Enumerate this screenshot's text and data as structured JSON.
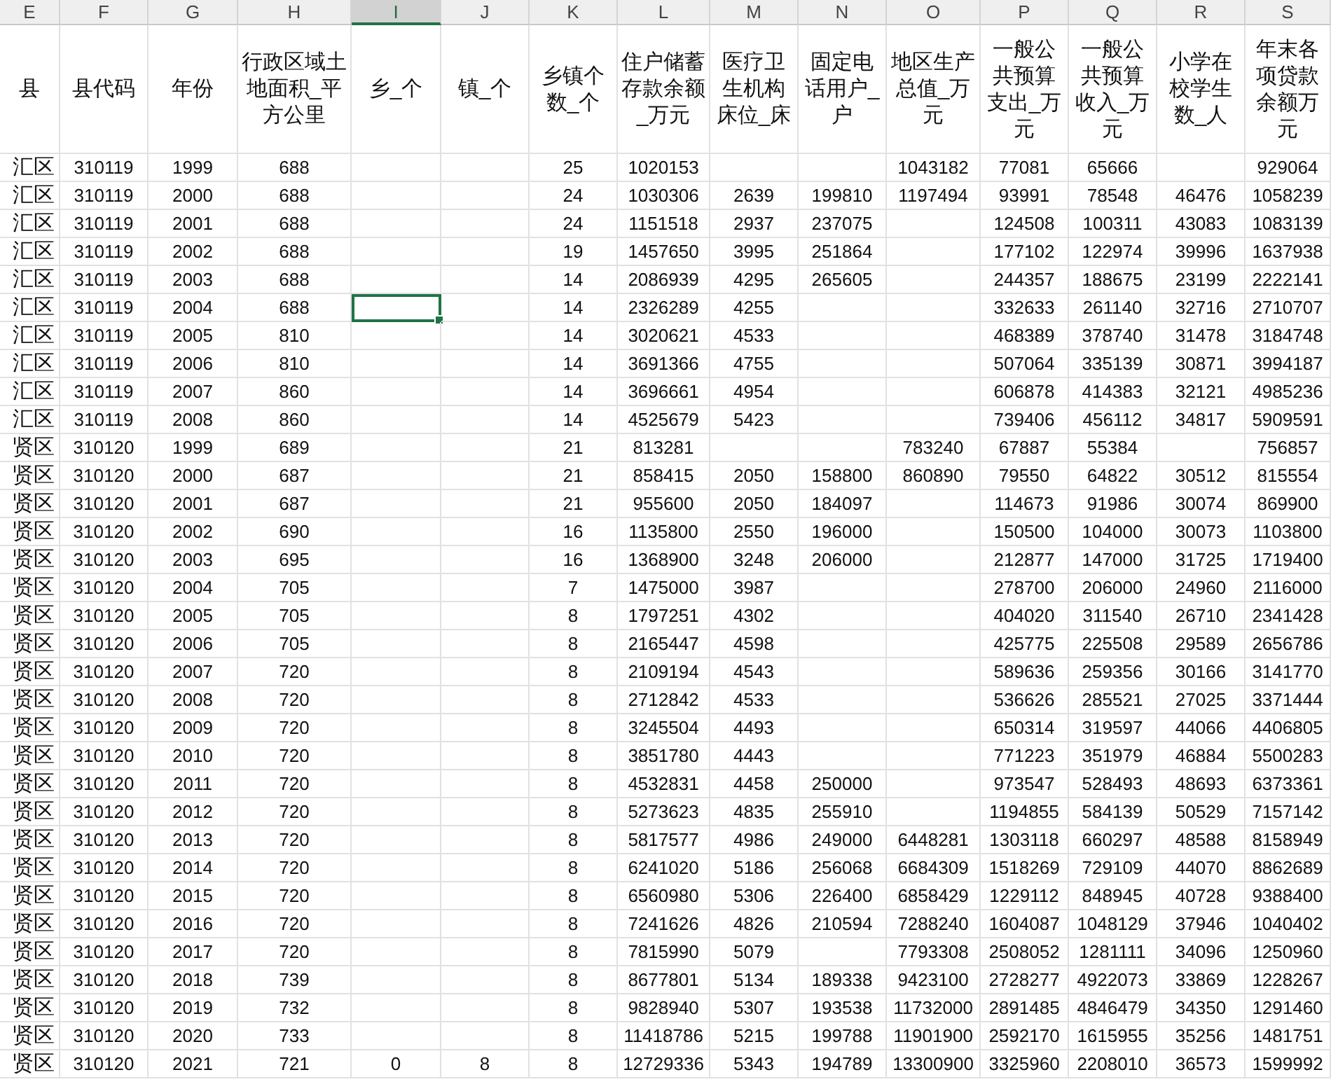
{
  "columns": [
    {
      "letter": "E",
      "selected": false
    },
    {
      "letter": "F",
      "selected": false
    },
    {
      "letter": "G",
      "selected": false
    },
    {
      "letter": "H",
      "selected": false
    },
    {
      "letter": "I",
      "selected": true
    },
    {
      "letter": "J",
      "selected": false
    },
    {
      "letter": "K",
      "selected": false
    },
    {
      "letter": "L",
      "selected": false
    },
    {
      "letter": "M",
      "selected": false
    },
    {
      "letter": "N",
      "selected": false
    },
    {
      "letter": "O",
      "selected": false
    },
    {
      "letter": "P",
      "selected": false
    },
    {
      "letter": "Q",
      "selected": false
    },
    {
      "letter": "R",
      "selected": false
    },
    {
      "letter": "S",
      "selected": false
    }
  ],
  "headers": [
    "县",
    "县代码",
    "年份",
    "行政区域土地面积_平方公里",
    "乡_个",
    "镇_个",
    "乡镇个数_个",
    "住户储蓄存款余额_万元",
    "医疗卫生机构床位_床",
    "固定电话用户_户",
    "地区生产总值_万元",
    "一般公共预算支出_万元",
    "一般公共预算收入_万元",
    "小学在校学生数_人",
    "年末各项贷款余额万元"
  ],
  "rows": [
    {
      "selected": false,
      "cells": [
        "汇区",
        "310119",
        "1999",
        "688",
        null,
        null,
        "25",
        "1020153",
        null,
        null,
        "1043182",
        "77081",
        "65666",
        null,
        "929064"
      ]
    },
    {
      "selected": false,
      "cells": [
        "汇区",
        "310119",
        "2000",
        "688",
        null,
        null,
        "24",
        "1030306",
        "2639",
        "199810",
        "1197494",
        "93991",
        "78548",
        "46476",
        "1058239"
      ]
    },
    {
      "selected": false,
      "cells": [
        "汇区",
        "310119",
        "2001",
        "688",
        null,
        null,
        "24",
        "1151518",
        "2937",
        "237075",
        null,
        "124508",
        "100311",
        "43083",
        "1083139"
      ]
    },
    {
      "selected": false,
      "cells": [
        "汇区",
        "310119",
        "2002",
        "688",
        null,
        null,
        "19",
        "1457650",
        "3995",
        "251864",
        null,
        "177102",
        "122974",
        "39996",
        "1637938"
      ]
    },
    {
      "selected": false,
      "cells": [
        "汇区",
        "310119",
        "2003",
        "688",
        null,
        null,
        "14",
        "2086939",
        "4295",
        "265605",
        null,
        "244357",
        "188675",
        "23199",
        "2222141"
      ]
    },
    {
      "selected": true,
      "cells": [
        "汇区",
        "310119",
        "2004",
        "688",
        null,
        null,
        "14",
        "2326289",
        "4255",
        null,
        null,
        "332633",
        "261140",
        "32716",
        "2710707"
      ]
    },
    {
      "selected": false,
      "cells": [
        "汇区",
        "310119",
        "2005",
        "810",
        null,
        null,
        "14",
        "3020621",
        "4533",
        null,
        null,
        "468389",
        "378740",
        "31478",
        "3184748"
      ]
    },
    {
      "selected": false,
      "cells": [
        "汇区",
        "310119",
        "2006",
        "810",
        null,
        null,
        "14",
        "3691366",
        "4755",
        null,
        null,
        "507064",
        "335139",
        "30871",
        "3994187"
      ]
    },
    {
      "selected": false,
      "cells": [
        "汇区",
        "310119",
        "2007",
        "860",
        null,
        null,
        "14",
        "3696661",
        "4954",
        null,
        null,
        "606878",
        "414383",
        "32121",
        "4985236"
      ]
    },
    {
      "selected": false,
      "cells": [
        "汇区",
        "310119",
        "2008",
        "860",
        null,
        null,
        "14",
        "4525679",
        "5423",
        null,
        null,
        "739406",
        "456112",
        "34817",
        "5909591"
      ]
    },
    {
      "selected": false,
      "cells": [
        "贤区",
        "310120",
        "1999",
        "689",
        null,
        null,
        "21",
        "813281",
        null,
        null,
        "783240",
        "67887",
        "55384",
        null,
        "756857"
      ]
    },
    {
      "selected": false,
      "cells": [
        "贤区",
        "310120",
        "2000",
        "687",
        null,
        null,
        "21",
        "858415",
        "2050",
        "158800",
        "860890",
        "79550",
        "64822",
        "30512",
        "815554"
      ]
    },
    {
      "selected": false,
      "cells": [
        "贤区",
        "310120",
        "2001",
        "687",
        null,
        null,
        "21",
        "955600",
        "2050",
        "184097",
        null,
        "114673",
        "91986",
        "30074",
        "869900"
      ]
    },
    {
      "selected": false,
      "cells": [
        "贤区",
        "310120",
        "2002",
        "690",
        null,
        null,
        "16",
        "1135800",
        "2550",
        "196000",
        null,
        "150500",
        "104000",
        "30073",
        "1103800"
      ]
    },
    {
      "selected": false,
      "cells": [
        "贤区",
        "310120",
        "2003",
        "695",
        null,
        null,
        "16",
        "1368900",
        "3248",
        "206000",
        null,
        "212877",
        "147000",
        "31725",
        "1719400"
      ]
    },
    {
      "selected": false,
      "cells": [
        "贤区",
        "310120",
        "2004",
        "705",
        null,
        null,
        "7",
        "1475000",
        "3987",
        null,
        null,
        "278700",
        "206000",
        "24960",
        "2116000"
      ]
    },
    {
      "selected": false,
      "cells": [
        "贤区",
        "310120",
        "2005",
        "705",
        null,
        null,
        "8",
        "1797251",
        "4302",
        null,
        null,
        "404020",
        "311540",
        "26710",
        "2341428"
      ]
    },
    {
      "selected": false,
      "cells": [
        "贤区",
        "310120",
        "2006",
        "705",
        null,
        null,
        "8",
        "2165447",
        "4598",
        null,
        null,
        "425775",
        "225508",
        "29589",
        "2656786"
      ]
    },
    {
      "selected": false,
      "cells": [
        "贤区",
        "310120",
        "2007",
        "720",
        null,
        null,
        "8",
        "2109194",
        "4543",
        null,
        null,
        "589636",
        "259356",
        "30166",
        "3141770"
      ]
    },
    {
      "selected": false,
      "cells": [
        "贤区",
        "310120",
        "2008",
        "720",
        null,
        null,
        "8",
        "2712842",
        "4533",
        null,
        null,
        "536626",
        "285521",
        "27025",
        "3371444"
      ]
    },
    {
      "selected": false,
      "cells": [
        "贤区",
        "310120",
        "2009",
        "720",
        null,
        null,
        "8",
        "3245504",
        "4493",
        null,
        null,
        "650314",
        "319597",
        "44066",
        "4406805"
      ]
    },
    {
      "selected": false,
      "cells": [
        "贤区",
        "310120",
        "2010",
        "720",
        null,
        null,
        "8",
        "3851780",
        "4443",
        null,
        null,
        "771223",
        "351979",
        "46884",
        "5500283"
      ]
    },
    {
      "selected": false,
      "cells": [
        "贤区",
        "310120",
        "2011",
        "720",
        null,
        null,
        "8",
        "4532831",
        "4458",
        "250000",
        null,
        "973547",
        "528493",
        "48693",
        "6373361"
      ]
    },
    {
      "selected": false,
      "cells": [
        "贤区",
        "310120",
        "2012",
        "720",
        null,
        null,
        "8",
        "5273623",
        "4835",
        "255910",
        null,
        "1194855",
        "584139",
        "50529",
        "7157142"
      ]
    },
    {
      "selected": false,
      "cells": [
        "贤区",
        "310120",
        "2013",
        "720",
        null,
        null,
        "8",
        "5817577",
        "4986",
        "249000",
        "6448281",
        "1303118",
        "660297",
        "48588",
        "8158949"
      ]
    },
    {
      "selected": false,
      "cells": [
        "贤区",
        "310120",
        "2014",
        "720",
        null,
        null,
        "8",
        "6241020",
        "5186",
        "256068",
        "6684309",
        "1518269",
        "729109",
        "44070",
        "8862689"
      ]
    },
    {
      "selected": false,
      "cells": [
        "贤区",
        "310120",
        "2015",
        "720",
        null,
        null,
        "8",
        "6560980",
        "5306",
        "226400",
        "6858429",
        "1229112",
        "848945",
        "40728",
        "9388400"
      ]
    },
    {
      "selected": false,
      "cells": [
        "贤区",
        "310120",
        "2016",
        "720",
        null,
        null,
        "8",
        "7241626",
        "4826",
        "210594",
        "7288240",
        "1604087",
        "1048129",
        "37946",
        "1040402"
      ]
    },
    {
      "selected": false,
      "cells": [
        "贤区",
        "310120",
        "2017",
        "720",
        null,
        null,
        "8",
        "7815990",
        "5079",
        null,
        "7793308",
        "2508052",
        "1281111",
        "34096",
        "1250960"
      ]
    },
    {
      "selected": false,
      "cells": [
        "贤区",
        "310120",
        "2018",
        "739",
        null,
        null,
        "8",
        "8677801",
        "5134",
        "189338",
        "9423100",
        "2728277",
        "4922073",
        "33869",
        "1228267"
      ]
    },
    {
      "selected": false,
      "cells": [
        "贤区",
        "310120",
        "2019",
        "732",
        null,
        null,
        "8",
        "9828940",
        "5307",
        "193538",
        "11732000",
        "2891485",
        "4846479",
        "34350",
        "1291460"
      ]
    },
    {
      "selected": false,
      "cells": [
        "贤区",
        "310120",
        "2020",
        "733",
        null,
        null,
        "8",
        "11418786",
        "5215",
        "199788",
        "11901900",
        "2592170",
        "1615955",
        "35256",
        "1481751"
      ]
    },
    {
      "selected": false,
      "cells": [
        "贤区",
        "310120",
        "2021",
        "721",
        "0",
        "8",
        "8",
        "12729336",
        "5343",
        "194789",
        "13300900",
        "3325960",
        "2208010",
        "36573",
        "1599992"
      ]
    }
  ]
}
